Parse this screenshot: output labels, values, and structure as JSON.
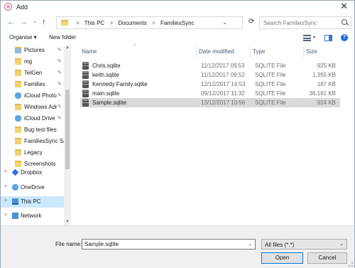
{
  "window": {
    "title": "Add",
    "close_glyph": "✕",
    "app_icon": "app-icon"
  },
  "nav": {
    "back_glyph": "←",
    "forward_glyph": "→",
    "recent_glyph": "⌄",
    "up_glyph": "↑",
    "refresh_glyph": "⟳",
    "address_dropdown_glyph": "⌄",
    "breadcrumbs": [
      "This PC",
      "Documents",
      "FamiliesSync"
    ],
    "breadcrumb_separator": ">",
    "search_placeholder": "Search FamiliesSync"
  },
  "toolbar": {
    "organise_label": "Organise ▾",
    "new_folder_label": "New folder",
    "view_chevron": "▾",
    "help_glyph": "?"
  },
  "sidebar": {
    "items": [
      {
        "label": "Pictures",
        "icon": "pictures-folder-icon",
        "pinned": true
      },
      {
        "label": "mg",
        "icon": "folder-icon",
        "pinned": true
      },
      {
        "label": "TelGen",
        "icon": "folder-icon",
        "pinned": true
      },
      {
        "label": "Families",
        "icon": "folder-icon",
        "pinned": true
      },
      {
        "label": "iCloud Photos",
        "icon": "icloud-photos-icon",
        "pinned": true
      },
      {
        "label": "Windows Admin",
        "icon": "folder-icon",
        "pinned": true
      },
      {
        "label": "iCloud Drive",
        "icon": "icloud-drive-icon",
        "pinned": true
      },
      {
        "label": "Bug test files",
        "icon": "folder-icon",
        "pinned": false
      },
      {
        "label": "FamiliesSync Sav",
        "icon": "folder-icon",
        "pinned": false
      },
      {
        "label": "Legacy",
        "icon": "folder-icon",
        "pinned": false
      },
      {
        "label": "Screenshots",
        "icon": "folder-icon",
        "pinned": false
      },
      {
        "label": "Dropbox",
        "icon": "dropbox-icon",
        "pinned": false
      },
      {
        "label": "OneDrive",
        "icon": "onedrive-icon",
        "pinned": false
      },
      {
        "label": "This PC",
        "icon": "this-pc-icon",
        "pinned": false
      },
      {
        "label": "Network",
        "icon": "network-icon",
        "pinned": false
      }
    ],
    "pin_glyph": "✎",
    "expand_glyph": ">"
  },
  "file_list": {
    "columns": [
      "Name",
      "Date modified",
      "Type",
      "Size"
    ],
    "sort_glyph": "^",
    "rows": [
      {
        "name": "Chris.sqlite",
        "date": "11/12/2017 09:53",
        "type": "SQLITE File",
        "size": "925 KB"
      },
      {
        "name": "keith.sqlite",
        "date": "11/12/2017 09:52",
        "type": "SQLITE File",
        "size": "1,355 KB"
      },
      {
        "name": "Kennedy Family.sqlite",
        "date": "12/12/2017 14:53",
        "type": "SQLITE File",
        "size": "187 KB"
      },
      {
        "name": "main.sqlite",
        "date": "09/12/2017 11:32",
        "type": "SQLITE File",
        "size": "36,161 KB"
      },
      {
        "name": "Sample.sqlite",
        "date": "13/12/2017 10:56",
        "type": "SQLITE File",
        "size": "924 KB"
      }
    ],
    "selected_index": 4
  },
  "footer": {
    "file_name_label": "File name:",
    "file_name_value": "Sample.sqlite",
    "file_type_value": "All files (*.*)",
    "dropdown_glyph": "⌄",
    "open_label": "Open",
    "cancel_label": "Cancel"
  },
  "colors": {
    "selection": "#cce8ff",
    "row_selected": "#d9d9d9",
    "primary_border": "#0078d7"
  }
}
